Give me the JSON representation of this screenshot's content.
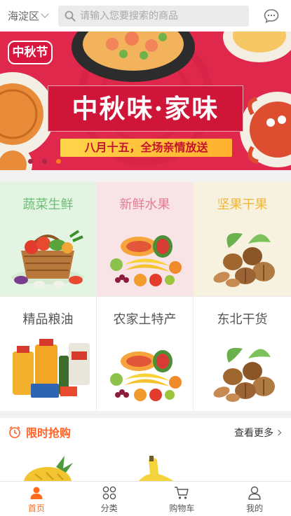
{
  "header": {
    "region": "海淀区",
    "search_placeholder": "请输入您要搜索的商品"
  },
  "banner": {
    "logo_text": "中秋节",
    "title": "中秋味·家味",
    "subtitle": "八月十五，全场亲情放送",
    "slide_count": 3,
    "active_slide": 3
  },
  "categories": [
    {
      "label": "蔬菜生鲜",
      "label_color": "#6cbf76",
      "bg": "#e3f4e2",
      "icon": "vegetable-basket-icon"
    },
    {
      "label": "新鲜水果",
      "label_color": "#e97a93",
      "bg": "#f8e3e6",
      "icon": "fruit-pile-icon"
    },
    {
      "label": "坚果干果",
      "label_color": "#f0b63a",
      "bg": "#f7f2e0",
      "icon": "walnut-icon"
    },
    {
      "label": "精品粮油",
      "label_color": "#555555",
      "bg": "#ffffff",
      "icon": "grain-oil-icon"
    },
    {
      "label": "农家土特产",
      "label_color": "#555555",
      "bg": "#ffffff",
      "icon": "fruit-pile-icon"
    },
    {
      "label": "东北干货",
      "label_color": "#555555",
      "bg": "#ffffff",
      "icon": "walnut-icon"
    }
  ],
  "flash_sale": {
    "title": "限时抢购",
    "more": "查看更多"
  },
  "tabbar": [
    {
      "label": "首页",
      "icon": "home-user-icon",
      "active": true
    },
    {
      "label": "分类",
      "icon": "category-grid-icon",
      "active": false
    },
    {
      "label": "购物车",
      "icon": "cart-icon",
      "active": false
    },
    {
      "label": "我的",
      "icon": "profile-icon",
      "active": false
    }
  ],
  "colors": {
    "accent": "#ff6b1d",
    "banner_red": "#e0284c"
  }
}
